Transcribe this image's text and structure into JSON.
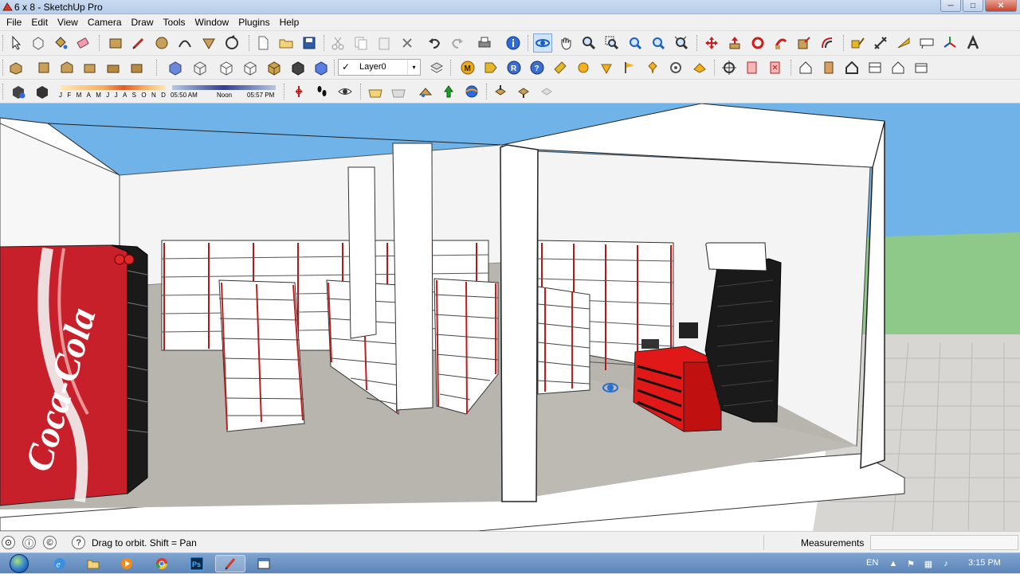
{
  "window": {
    "title": "6 x 8 - SketchUp Pro",
    "controls": {
      "minimize": "─",
      "maximize": "□",
      "close": "✕"
    }
  },
  "menu": [
    "File",
    "Edit",
    "View",
    "Camera",
    "Draw",
    "Tools",
    "Window",
    "Plugins",
    "Help"
  ],
  "layers": {
    "current": "Layer0",
    "check": "✓",
    "arrow": "▾"
  },
  "shadows": {
    "months": [
      "J",
      "F",
      "M",
      "A",
      "M",
      "J",
      "J",
      "A",
      "S",
      "O",
      "N",
      "D"
    ],
    "time_start": "05:50 AM",
    "time_noon": "Noon",
    "time_end": "05:57 PM"
  },
  "status": {
    "hint": "Drag to orbit.  Shift = Pan",
    "measurements_label": "Measurements",
    "measurements_value": "",
    "help_glyph": "?"
  },
  "taskbar": {
    "language": "EN",
    "clock": "3:15 PM"
  },
  "scene": {
    "fridge_brand": "Coca-Cola",
    "sky_color": "#6fb3e8",
    "grass_color": "#8fc98a",
    "paving_color": "#d8d6d3",
    "floor_color": "#b8b4ae",
    "shelf_red": "#d01c1c",
    "counter_red": "#e01818"
  }
}
